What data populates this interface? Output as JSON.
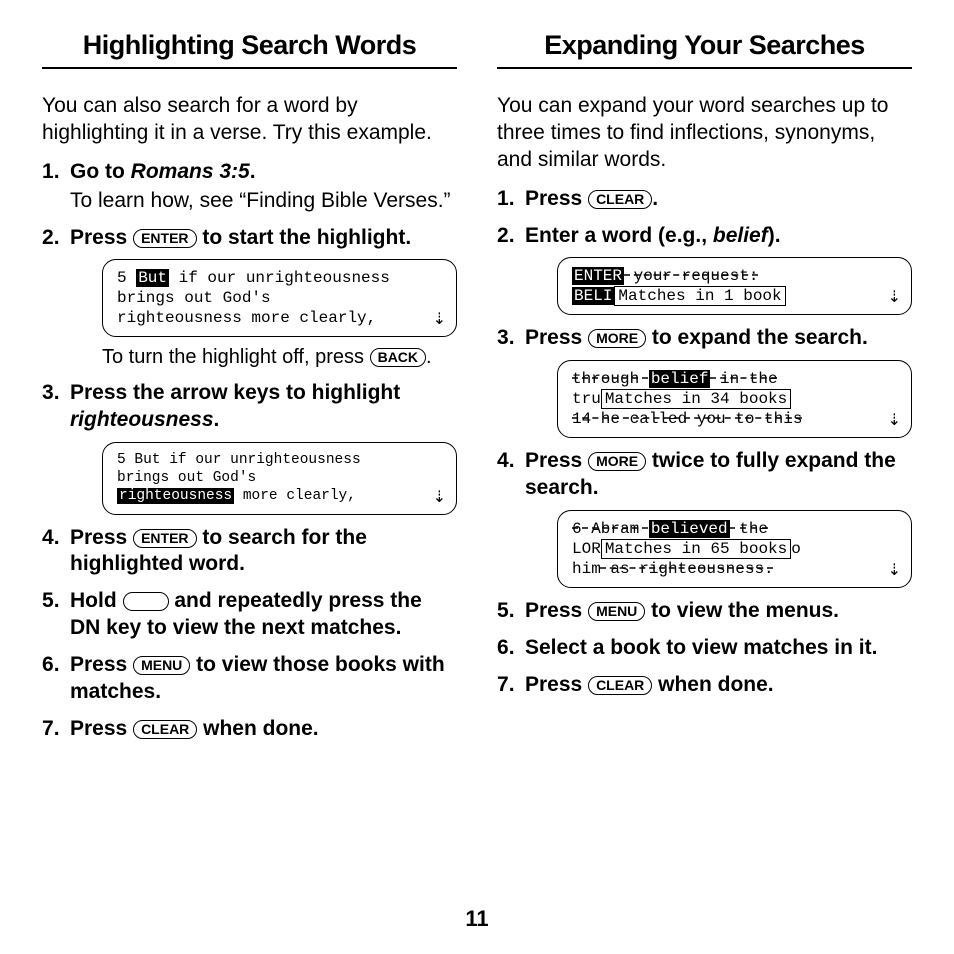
{
  "pageNumber": "11",
  "keys": {
    "enter": "ENTER",
    "back": "BACK",
    "menu": "MENU",
    "clear": "CLEAR",
    "more": "MORE"
  },
  "left": {
    "title": "Highlighting Search Words",
    "intro": "You can also search for a word by highlighting it in a verse. Try this example.",
    "step1_a": "Go to ",
    "step1_b": "Romans 3:5",
    "step1_c": ".",
    "step1_sub": "To learn how, see “Finding Bible Verses.”",
    "step2_a": "Press ",
    "step2_b": " to start the highlight.",
    "lcd1_pre": "5 ",
    "lcd1_hl": "But",
    "lcd1_rest": " if our unrighteousness\nbrings out God's\nrighteousness more clearly,",
    "caption_a": "To turn the highlight off, press ",
    "caption_b": ".",
    "step3_a": "Press the arrow keys to highlight ",
    "step3_b": "righteousness",
    "step3_c": ".",
    "lcd2_line1": "5 But if our unrighteousness",
    "lcd2_line2": "brings out God's",
    "lcd2_hl": "righteousness",
    "lcd2_rest": " more clearly,",
    "step4_a": "Press ",
    "step4_b": " to search for the highlighted word.",
    "step5_a": "Hold ",
    "step5_b": " and repeatedly press the DN key to view the next matches.",
    "step6_a": "Press ",
    "step6_b": " to view those books with matches.",
    "step7_a": "Press ",
    "step7_b": " when done."
  },
  "right": {
    "title": "Expanding Your Searches",
    "intro": "You can expand your word searches up to three times to find inflections, synonyms, and similar words.",
    "step1_a": "Press ",
    "step1_b": ".",
    "step2_a": "Enter a word (e.g., ",
    "step2_b": "belief",
    "step2_c": ").",
    "lcd1_top_hl": "ENTER",
    "lcd1_top_rest": " your request:",
    "lcd1_left": "BELI",
    "lcd1_box": "Matches in 1 book",
    "step3_a": "Press ",
    "step3_b": " to expand the search.",
    "lcd2_line1a": "through ",
    "lcd2_line1b": "belief",
    "lcd2_line1c": " in the",
    "lcd2_left": "tru",
    "lcd2_box": "Matches in 34 books",
    "lcd2_line3": "14 he called you to this",
    "step4_a": "Press ",
    "step4_b": " twice to fully expand the search.",
    "lcd3_line1a": "6 Abram ",
    "lcd3_line1b": "believed",
    "lcd3_line1c": " the",
    "lcd3_left": "LOR",
    "lcd3_box": "Matches in 65 books",
    "lcd3_right": "o",
    "lcd3_line3a": "him",
    "lcd3_line3b": " as righteousness.",
    "step5_a": "Press ",
    "step5_b": " to view the menus.",
    "step6": "Select a book to view matches in it.",
    "step7_a": "Press ",
    "step7_b": " when done."
  }
}
